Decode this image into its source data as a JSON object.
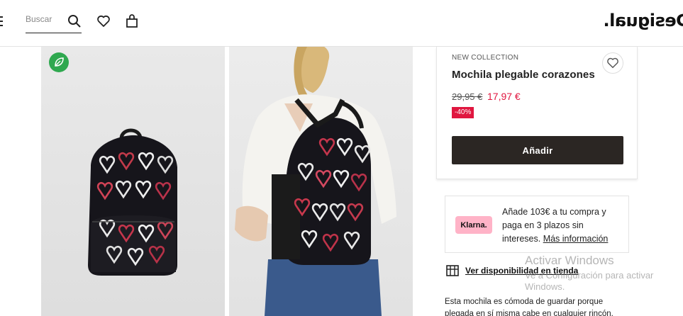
{
  "header": {
    "search_placeholder": "Buscar",
    "logo": "Desigual."
  },
  "gallery": {
    "eco_badge_icon": "leaf-icon"
  },
  "product": {
    "collection": "NEW COLLECTION",
    "title": "Mochila plegable corazones",
    "old_price": "29,95 €",
    "new_price": "17,97 €",
    "discount": "-40%",
    "add_label": "Añadir",
    "accent_color": "#e0163f"
  },
  "klarna": {
    "logo": "Klarna.",
    "text": "Añade 103€ a tu compra y paga en 3 plazos sin intereses.",
    "link": "Más información"
  },
  "availability": {
    "link": "Ver disponibilidad en tienda"
  },
  "description": "Esta mochila es cómoda de guardar porque plegada en sí misma cabe en cualquier rincón.",
  "watermark": {
    "title": "Activar Windows",
    "subtitle": "Ve a Configuración para activar Windows."
  }
}
